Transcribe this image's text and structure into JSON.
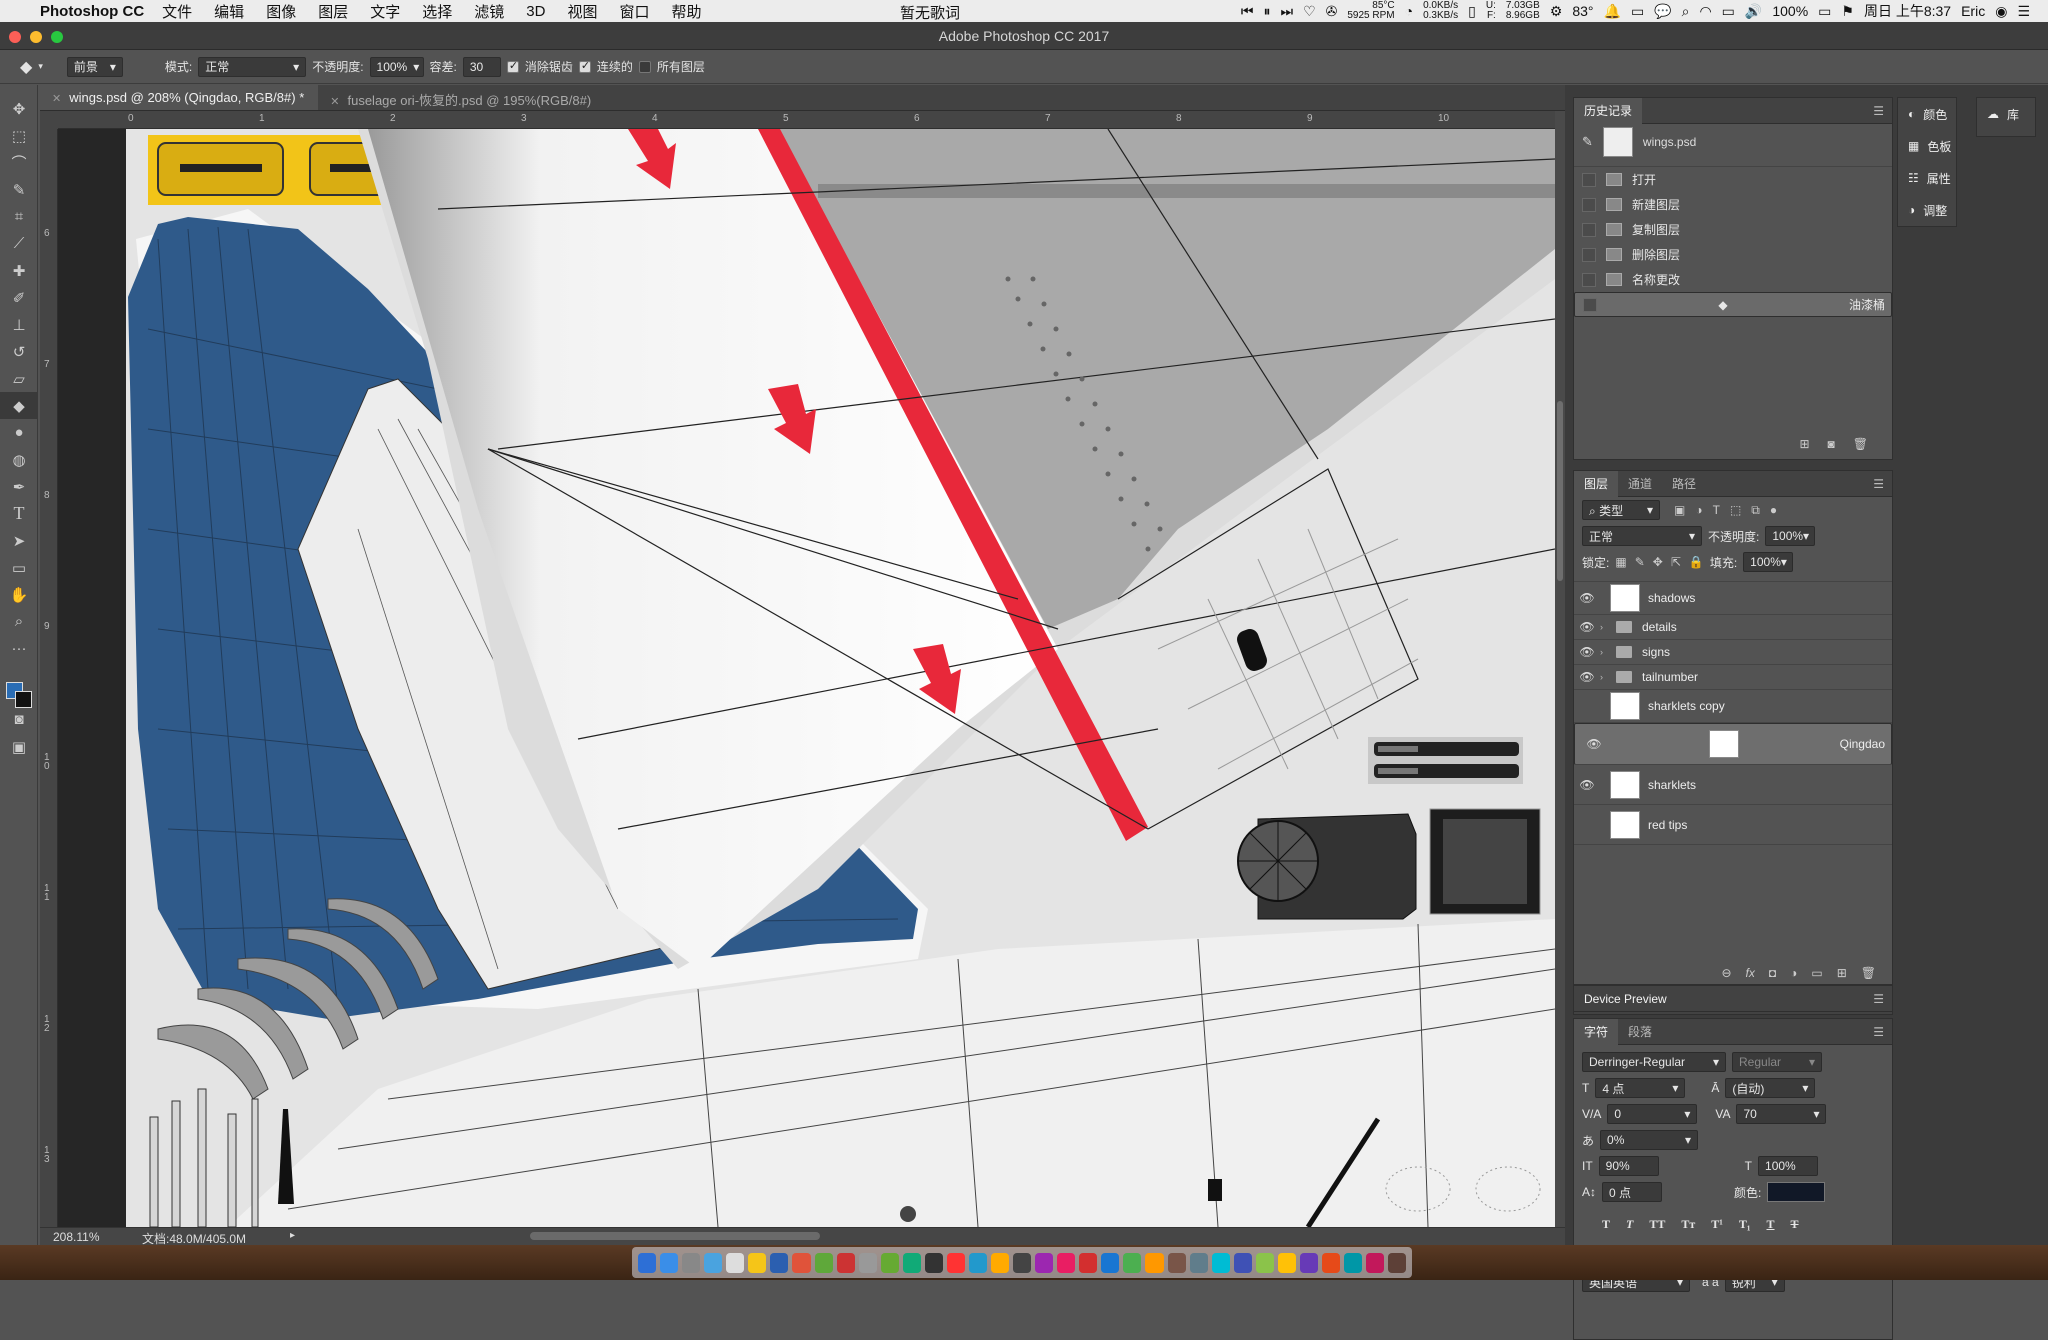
{
  "menubar": {
    "app": "Photoshop CC",
    "items": [
      "文件",
      "编辑",
      "图像",
      "图层",
      "文字",
      "选择",
      "滤镜",
      "3D",
      "视图",
      "窗口",
      "帮助"
    ],
    "lyric": "暂无歌词",
    "cpu_temp": "85°C",
    "fan": "5925 RPM",
    "net_up": "0.0KB/s",
    "net_down": "0.3KB/s",
    "mem_used": "7.03GB",
    "mem_free": "8.96GB",
    "mem_u": "U:",
    "mem_f": "F:",
    "temp": "83°",
    "battery": "100%",
    "datetime": "周日 上午8:37",
    "user": "Eric"
  },
  "titlebar": {
    "title": "Adobe Photoshop CC 2017"
  },
  "options": {
    "preset": "前景",
    "mode_label": "模式:",
    "mode_value": "正常",
    "opacity_label": "不透明度:",
    "opacity_value": "100%",
    "tolerance_label": "容差:",
    "tolerance_value": "30",
    "antialias": "消除锯齿",
    "contiguous": "连续的",
    "all_layers": "所有图层"
  },
  "tabs": [
    {
      "label": "wings.psd @ 208% (Qingdao, RGB/8#) *",
      "active": true
    },
    {
      "label": "fuselage ori-恢复的.psd @ 195%(RGB/8#)",
      "active": false
    }
  ],
  "ruler": {
    "h": [
      "0",
      "1",
      "2",
      "3",
      "4",
      "5",
      "6",
      "7",
      "8",
      "9",
      "10"
    ],
    "v": [
      "6",
      "7",
      "8",
      "9",
      "1 0",
      "1 1",
      "1 2",
      "1 3"
    ]
  },
  "status": {
    "zoom": "208.11%",
    "doc": "文档:48.0M/405.0M"
  },
  "history": {
    "title": "历史记录",
    "snapshot": "wings.psd",
    "items": [
      "打开",
      "新建图层",
      "复制图层",
      "删除图层",
      "名称更改",
      "油漆桶"
    ],
    "selected_index": 5
  },
  "side_panels": {
    "colors": "颜色",
    "swatches": "色板",
    "properties": "属性",
    "adjustments": "调整",
    "library": "库"
  },
  "layers": {
    "tabs": [
      "图层",
      "通道",
      "路径"
    ],
    "filter": "类型",
    "blend": "正常",
    "opacity_label": "不透明度:",
    "opacity": "100%",
    "lock_label": "锁定:",
    "fill_label": "填充:",
    "fill": "100%",
    "items": [
      {
        "name": "shadows",
        "kind": "layer",
        "visible": true
      },
      {
        "name": "details",
        "kind": "group",
        "visible": true
      },
      {
        "name": "signs",
        "kind": "group",
        "visible": true
      },
      {
        "name": "tailnumber",
        "kind": "group",
        "visible": true
      },
      {
        "name": "sharklets copy",
        "kind": "layer",
        "visible": false
      },
      {
        "name": "Qingdao",
        "kind": "layer",
        "visible": true,
        "selected": true
      },
      {
        "name": "sharklets",
        "kind": "layer",
        "visible": true
      },
      {
        "name": "red tips",
        "kind": "layer",
        "visible": false
      }
    ]
  },
  "device_preview": {
    "title": "Device Preview"
  },
  "character": {
    "tabs": [
      "字符",
      "段落"
    ],
    "font": "Derringer-Regular",
    "style": "Regular",
    "size": "4 点",
    "leading": "(自动)",
    "kerning": "0",
    "tracking": "70",
    "scale_pct": "0%",
    "vscale": "90%",
    "hscale": "100%",
    "baseline": "0 点",
    "color_label": "颜色:",
    "language": "英国英语",
    "aa_label": "a a",
    "aa": "锐利"
  },
  "colors": {
    "navy": "#2f5a8a",
    "red": "#e8283a",
    "yellow": "#f2c418",
    "accent_fg": "#2a6db5"
  }
}
